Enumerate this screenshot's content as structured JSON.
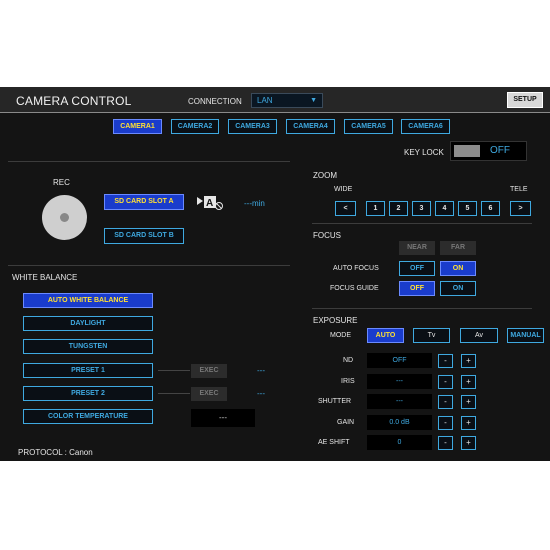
{
  "header": {
    "title": "CAMERA CONTROL",
    "connection_label": "CONNECTION",
    "connection_value": "LAN",
    "setup_label": "SETUP"
  },
  "cameras": [
    "CAMERA1",
    "CAMERA2",
    "CAMERA3",
    "CAMERA4",
    "CAMERA5",
    "CAMERA6"
  ],
  "key_lock": {
    "label": "KEY LOCK",
    "state": "OFF"
  },
  "rec": {
    "label": "REC",
    "slot_a": "SD CARD SLOT A",
    "slot_b": "SD CARD SLOT B",
    "remaining": "---min"
  },
  "white_balance": {
    "title": "WHITE BALANCE",
    "auto": "AUTO WHITE BALANCE",
    "daylight": "DAYLIGHT",
    "tungsten": "TUNGSTEN",
    "preset1": "PRESET 1",
    "preset2": "PRESET 2",
    "color_temp": "COLOR TEMPERATURE",
    "exec": "EXEC",
    "preset1_value": "---",
    "preset2_value": "---",
    "color_temp_value": "---"
  },
  "protocol": "PROTOCOL : Canon",
  "zoom": {
    "title": "ZOOM",
    "wide": "WIDE",
    "tele": "TELE",
    "left": "<",
    "right": ">",
    "steps": [
      "1",
      "2",
      "3",
      "4",
      "5",
      "6"
    ]
  },
  "focus": {
    "title": "FOCUS",
    "near": "NEAR",
    "far": "FAR",
    "auto_focus": "AUTO FOCUS",
    "focus_guide": "FOCUS GUIDE",
    "off": "OFF",
    "on": "ON"
  },
  "exposure": {
    "title": "EXPOSURE",
    "mode_label": "MODE",
    "modes": [
      "AUTO",
      "Tv",
      "Av",
      "MANUAL"
    ],
    "nd_label": "ND",
    "nd_value": "OFF",
    "iris_label": "IRIS",
    "iris_value": "---",
    "shutter_label": "SHUTTER",
    "shutter_value": "---",
    "gain_label": "GAIN",
    "gain_value": "0.0 dB",
    "ae_label": "AE SHIFT",
    "ae_value": "0",
    "minus": "-",
    "plus": "+"
  },
  "colors": {
    "accent": "#3fa9e0",
    "active_bg": "#1a3ccc",
    "active_text": "#ffe033",
    "panel_bg": "#141414"
  }
}
